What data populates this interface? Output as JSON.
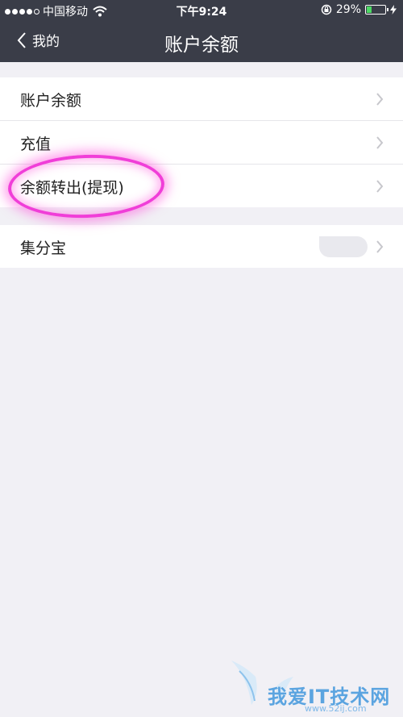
{
  "status_bar": {
    "carrier": "中国移动",
    "time": "下午9:24",
    "battery_text": "29%",
    "battery_level": 0.29,
    "signal_filled": 4,
    "signal_total": 5
  },
  "nav": {
    "back_label": "我的",
    "title": "账户余额"
  },
  "group1": {
    "items": [
      {
        "label": "账户余额"
      },
      {
        "label": "充值"
      },
      {
        "label": "余额转出(提现)"
      }
    ]
  },
  "group2": {
    "items": [
      {
        "label": "集分宝"
      }
    ]
  },
  "watermark": {
    "title": "我爱IT技术网",
    "sub": "www.52ij.com"
  },
  "colors": {
    "nav_bg": "#3a3d48",
    "page_bg": "#f1f0f5",
    "highlight": "#f03ed8"
  },
  "icons": [
    "wifi-icon",
    "lock-rotation-icon",
    "battery-icon",
    "charging-icon",
    "chevron-left-icon",
    "chevron-right-icon"
  ]
}
